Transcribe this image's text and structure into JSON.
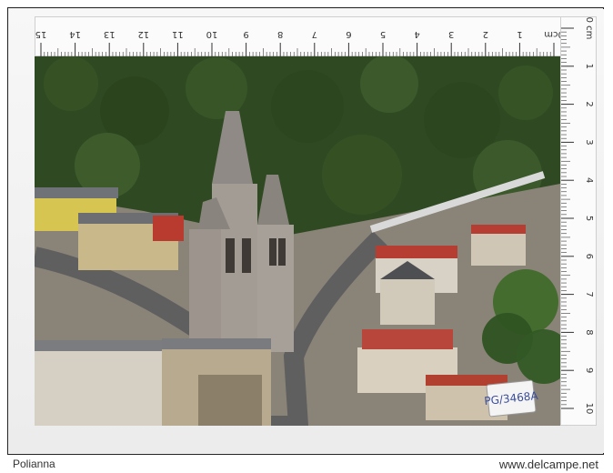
{
  "ruler": {
    "top_labels": [
      "15",
      "14",
      "13",
      "12",
      "11",
      "10",
      "9",
      "8",
      "7",
      "6",
      "5",
      "4",
      "3",
      "2",
      "1",
      "0cm"
    ],
    "side_labels": [
      "0 cm",
      "1",
      "2",
      "3",
      "4",
      "5",
      "6",
      "7",
      "8",
      "9",
      "10"
    ]
  },
  "photo": {
    "description_icon": "aerial-church-village-photo-icon",
    "colors": {
      "forest": "#2e4a22",
      "roof_red": "#b33a2e",
      "stone": "#9a8f86",
      "road": "#6a6a6a"
    }
  },
  "stamp": {
    "text": "PG/3468A"
  },
  "footer": {
    "left_text": "Polianna",
    "right_text": "www.delcampe.net"
  }
}
